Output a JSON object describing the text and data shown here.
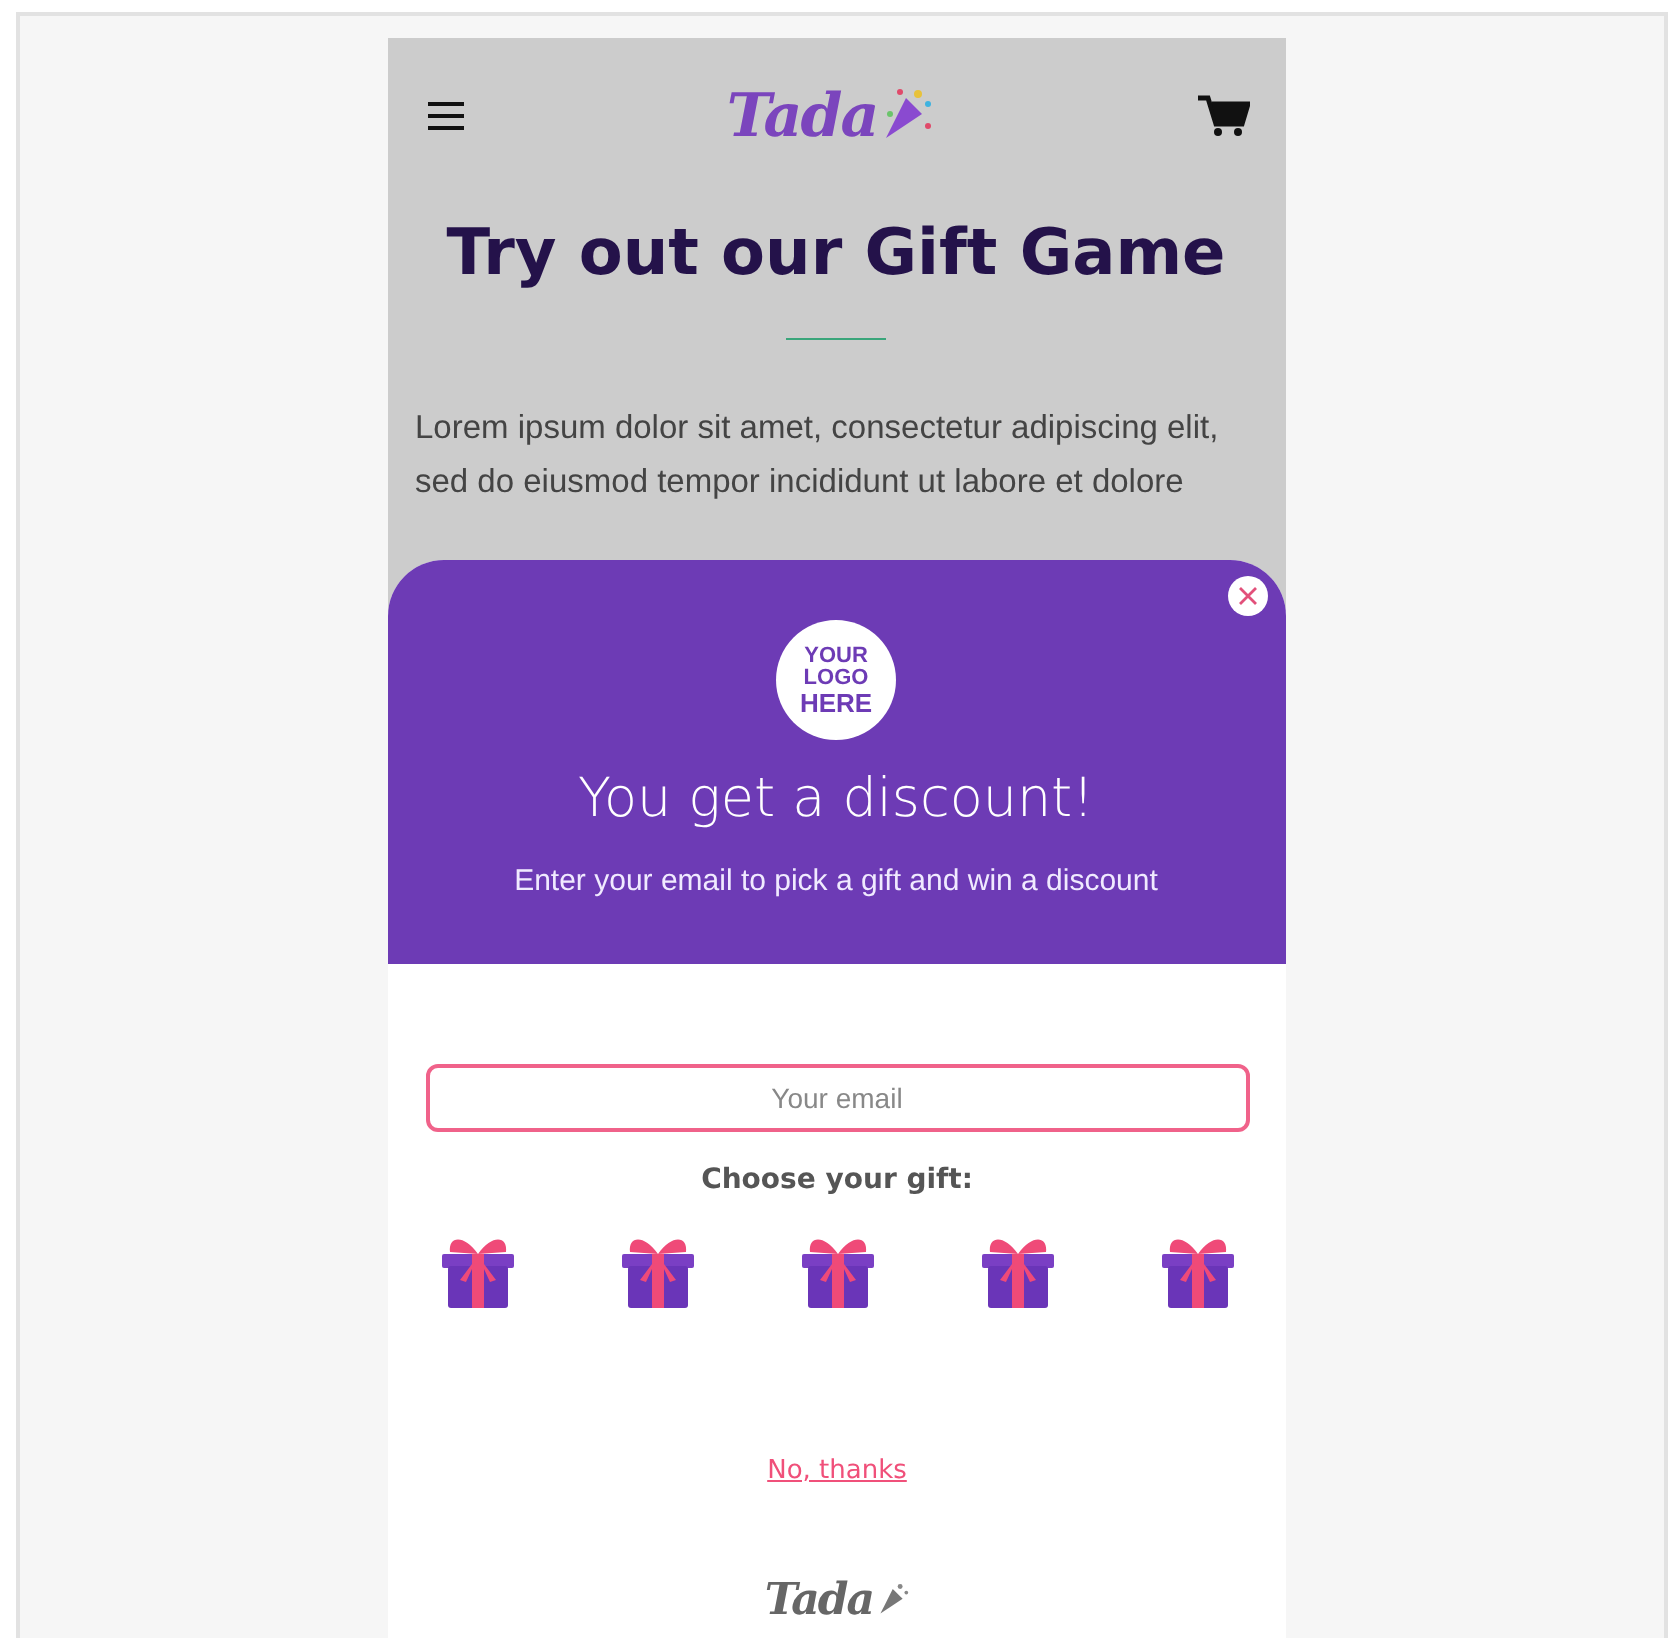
{
  "header": {
    "logo": "Tada"
  },
  "page": {
    "title": "Try out our Gift Game",
    "body": "Lorem ipsum dolor sit amet, consectetur adipiscing elit, sed do eiusmod tempor incididunt ut labore et dolore"
  },
  "popup": {
    "logo_lines": [
      "YOUR",
      "LOGO",
      "HERE"
    ],
    "title": "You get a discount!",
    "subtitle": "Enter your email to pick a gift and win a discount",
    "email": {
      "placeholder": "Your email"
    },
    "choose_label": "Choose your gift:",
    "gifts": [
      {
        "selected": false
      },
      {
        "selected": false
      },
      {
        "selected": false
      },
      {
        "selected": false
      },
      {
        "selected": false
      }
    ],
    "decline_link": "No, thanks",
    "footer_logo": "Tada"
  }
}
